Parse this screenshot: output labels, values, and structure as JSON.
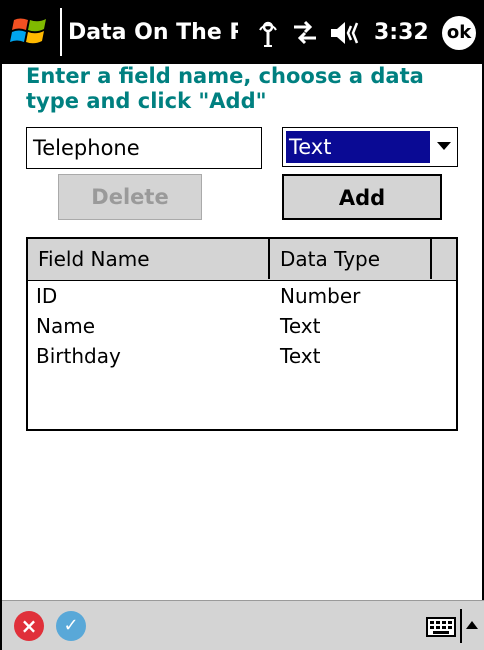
{
  "titlebar": {
    "app_title": "Data On The Run",
    "clock": "3:32",
    "ok_label": "ok"
  },
  "instruction": "Enter a field name, choose a data type and click \"Add\"",
  "form": {
    "field_name_value": "Telephone",
    "data_type_selected": "Text"
  },
  "buttons": {
    "delete_label": "Delete",
    "add_label": "Add"
  },
  "table": {
    "columns": [
      "Field Name",
      "Data Type"
    ],
    "rows": [
      {
        "field": "ID",
        "type": "Number"
      },
      {
        "field": "Name",
        "type": "Text"
      },
      {
        "field": "Birthday",
        "type": "Text"
      }
    ]
  },
  "colors": {
    "accent_text": "#008080",
    "selection": "#0a0a94"
  }
}
